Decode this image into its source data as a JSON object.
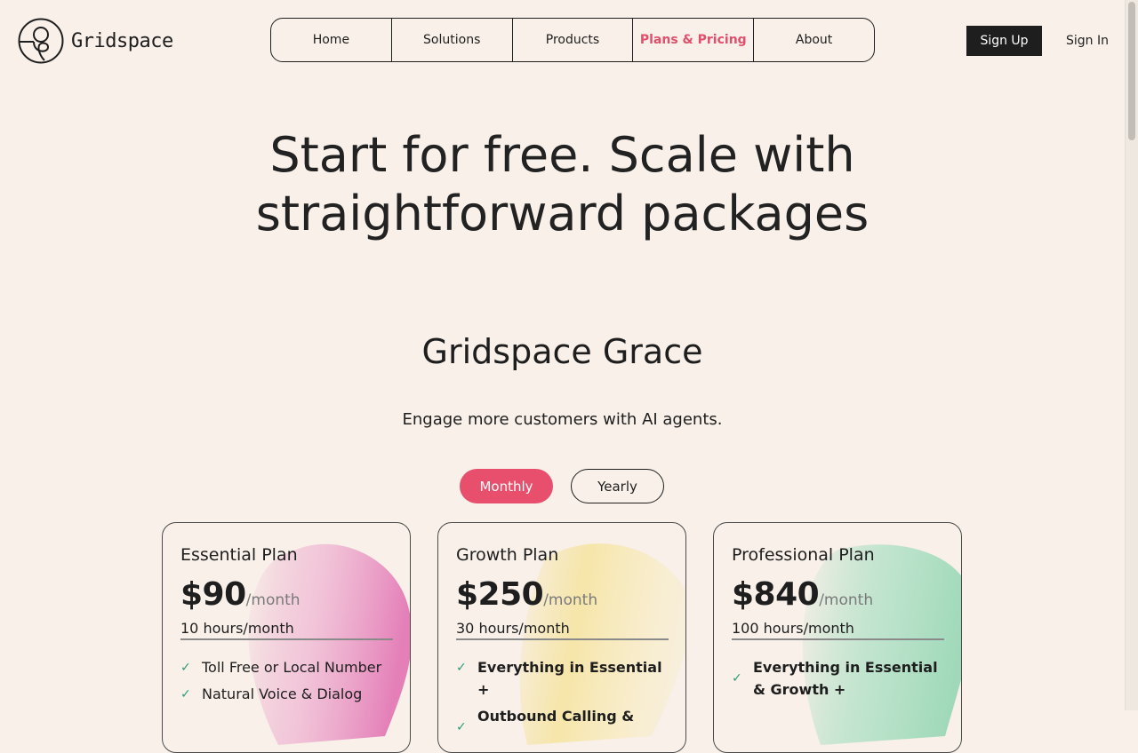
{
  "brand": {
    "name": "Gridspace"
  },
  "nav": {
    "items": [
      {
        "label": "Home"
      },
      {
        "label": "Solutions"
      },
      {
        "label": "Products"
      },
      {
        "label": "Plans & Pricing"
      },
      {
        "label": "About"
      }
    ],
    "active_index": 3
  },
  "auth": {
    "signup_label": "Sign Up",
    "signin_label": "Sign In"
  },
  "hero": {
    "title_line1": "Start for free. Scale with",
    "title_line2": "straightforward packages"
  },
  "section": {
    "title": "Gridspace Grace",
    "subtitle": "Engage more customers with AI agents."
  },
  "billing_toggle": {
    "monthly_label": "Monthly",
    "yearly_label": "Yearly",
    "selected": "Monthly"
  },
  "plans": [
    {
      "name": "Essential Plan",
      "price": "$90",
      "unit": "/month",
      "hours": "10 hours/month",
      "accent": "#e899c4",
      "features": [
        "Toll Free or Local Number",
        "Natural Voice & Dialog"
      ]
    },
    {
      "name": "Growth Plan",
      "price": "$250",
      "unit": "/month",
      "hours": "30 hours/month",
      "accent": "#f4e08c",
      "features": [
        "Everything in Essential +",
        "Outbound Calling &"
      ]
    },
    {
      "name": "Professional Plan",
      "price": "$840",
      "unit": "/month",
      "hours": "100 hours/month",
      "accent": "#a3dbbd",
      "features": [
        "Everything in Essential & Growth +"
      ]
    }
  ],
  "colors": {
    "background": "#f8f0e9",
    "accent": "#e84f6d",
    "dark": "#1e1e1e",
    "check": "#2d9b78"
  },
  "icons": {
    "check": "check-icon",
    "logo": "gridspace-logo-icon"
  }
}
